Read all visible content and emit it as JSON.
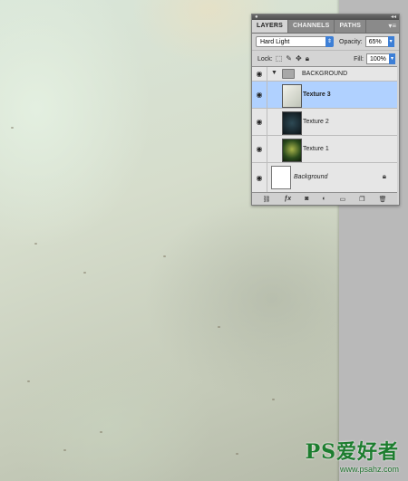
{
  "panel": {
    "tabs": [
      "LAYERS",
      "CHANNELS",
      "PATHS"
    ],
    "blend_mode": "Hard Light",
    "opacity_label": "Opacity:",
    "opacity_value": "65%",
    "lock_label": "Lock:",
    "fill_label": "Fill:",
    "fill_value": "100%",
    "group_name": "BACKGROUND",
    "layers": [
      {
        "name": "Texture 3",
        "selected": true
      },
      {
        "name": "Texture 2",
        "selected": false
      },
      {
        "name": "Texture 1",
        "selected": false
      }
    ],
    "background_layer": "Background"
  },
  "watermark": {
    "logo": "PS爱好者",
    "url": "www.psahz.com"
  }
}
